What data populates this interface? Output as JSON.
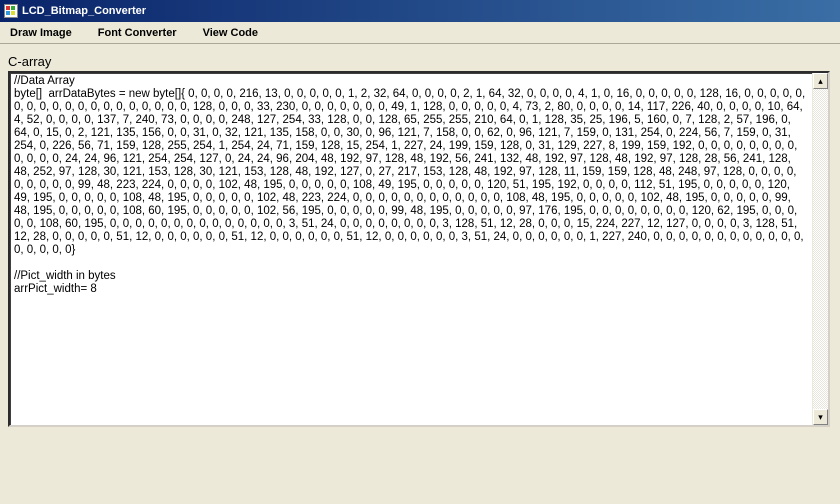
{
  "window": {
    "title": "LCD_Bitmap_Converter"
  },
  "menubar": {
    "items": [
      {
        "label": "Draw Image"
      },
      {
        "label": "Font Converter"
      },
      {
        "label": "View Code"
      }
    ]
  },
  "panel": {
    "label": "C-array",
    "content": "//Data Array\nbyte[]  arrDataBytes = new byte[]{ 0, 0, 0, 0, 216, 13, 0, 0, 0, 0, 0, 1, 2, 32, 64, 0, 0, 0, 0, 2, 1, 64, 32, 0, 0, 0, 0, 4, 1, 0, 16, 0, 0, 0, 0, 0, 128, 16, 0, 0, 0, 0, 0, 0, 0, 0, 0, 0, 0, 0, 0, 0, 0, 0, 0, 0, 0, 128, 0, 0, 0, 33, 230, 0, 0, 0, 0, 0, 0, 0, 49, 1, 128, 0, 0, 0, 0, 0, 4, 73, 2, 80, 0, 0, 0, 0, 14, 117, 226, 40, 0, 0, 0, 0, 10, 64, 4, 52, 0, 0, 0, 0, 137, 7, 240, 73, 0, 0, 0, 0, 248, 127, 254, 33, 128, 0, 0, 128, 65, 255, 255, 210, 64, 0, 1, 128, 35, 25, 196, 5, 160, 0, 7, 128, 2, 57, 196, 0, 64, 0, 15, 0, 2, 121, 135, 156, 0, 0, 31, 0, 32, 121, 135, 158, 0, 0, 30, 0, 96, 121, 7, 158, 0, 0, 62, 0, 96, 121, 7, 159, 0, 131, 254, 0, 224, 56, 7, 159, 0, 31, 254, 0, 226, 56, 71, 159, 128, 255, 254, 1, 254, 24, 71, 159, 128, 15, 254, 1, 227, 24, 199, 159, 128, 0, 31, 129, 227, 8, 199, 159, 192, 0, 0, 0, 0, 0, 0, 0, 0, 0, 0, 0, 0, 24, 24, 96, 121, 254, 254, 127, 0, 24, 24, 96, 204, 48, 192, 97, 128, 48, 192, 56, 241, 132, 48, 192, 97, 128, 48, 192, 97, 128, 28, 56, 241, 128, 48, 252, 97, 128, 30, 121, 153, 128, 30, 121, 153, 128, 48, 192, 127, 0, 27, 217, 153, 128, 48, 192, 97, 128, 11, 159, 159, 128, 48, 248, 97, 128, 0, 0, 0, 0, 0, 0, 0, 0, 0, 99, 48, 223, 224, 0, 0, 0, 0, 102, 48, 195, 0, 0, 0, 0, 0, 108, 49, 195, 0, 0, 0, 0, 0, 120, 51, 195, 192, 0, 0, 0, 0, 112, 51, 195, 0, 0, 0, 0, 0, 120, 49, 195, 0, 0, 0, 0, 0, 108, 48, 195, 0, 0, 0, 0, 0, 102, 48, 223, 224, 0, 0, 0, 0, 0, 0, 0, 0, 0, 0, 0, 0, 108, 48, 195, 0, 0, 0, 0, 0, 102, 48, 195, 0, 0, 0, 0, 0, 99, 48, 195, 0, 0, 0, 0, 0, 108, 60, 195, 0, 0, 0, 0, 0, 102, 56, 195, 0, 0, 0, 0, 0, 99, 48, 195, 0, 0, 0, 0, 0, 97, 176, 195, 0, 0, 0, 0, 0, 0, 0, 0, 120, 62, 195, 0, 0, 0, 0, 0, 108, 60, 195, 0, 0, 0, 0, 0, 0, 0, 0, 0, 0, 0, 0, 0, 0, 3, 51, 24, 0, 0, 0, 0, 0, 0, 0, 0, 3, 128, 51, 12, 28, 0, 0, 0, 15, 224, 227, 12, 127, 0, 0, 0, 0, 3, 128, 51, 12, 28, 0, 0, 0, 0, 0, 51, 12, 0, 0, 0, 0, 0, 0, 51, 12, 0, 0, 0, 0, 0, 0, 51, 12, 0, 0, 0, 0, 0, 0, 3, 51, 24, 0, 0, 0, 0, 0, 0, 1, 227, 240, 0, 0, 0, 0, 0, 0, 0, 0, 0, 0, 0, 0, 0, 0, 0, 0, 0}\n\n//Pict_width in bytes\narrPict_width= 8"
  }
}
